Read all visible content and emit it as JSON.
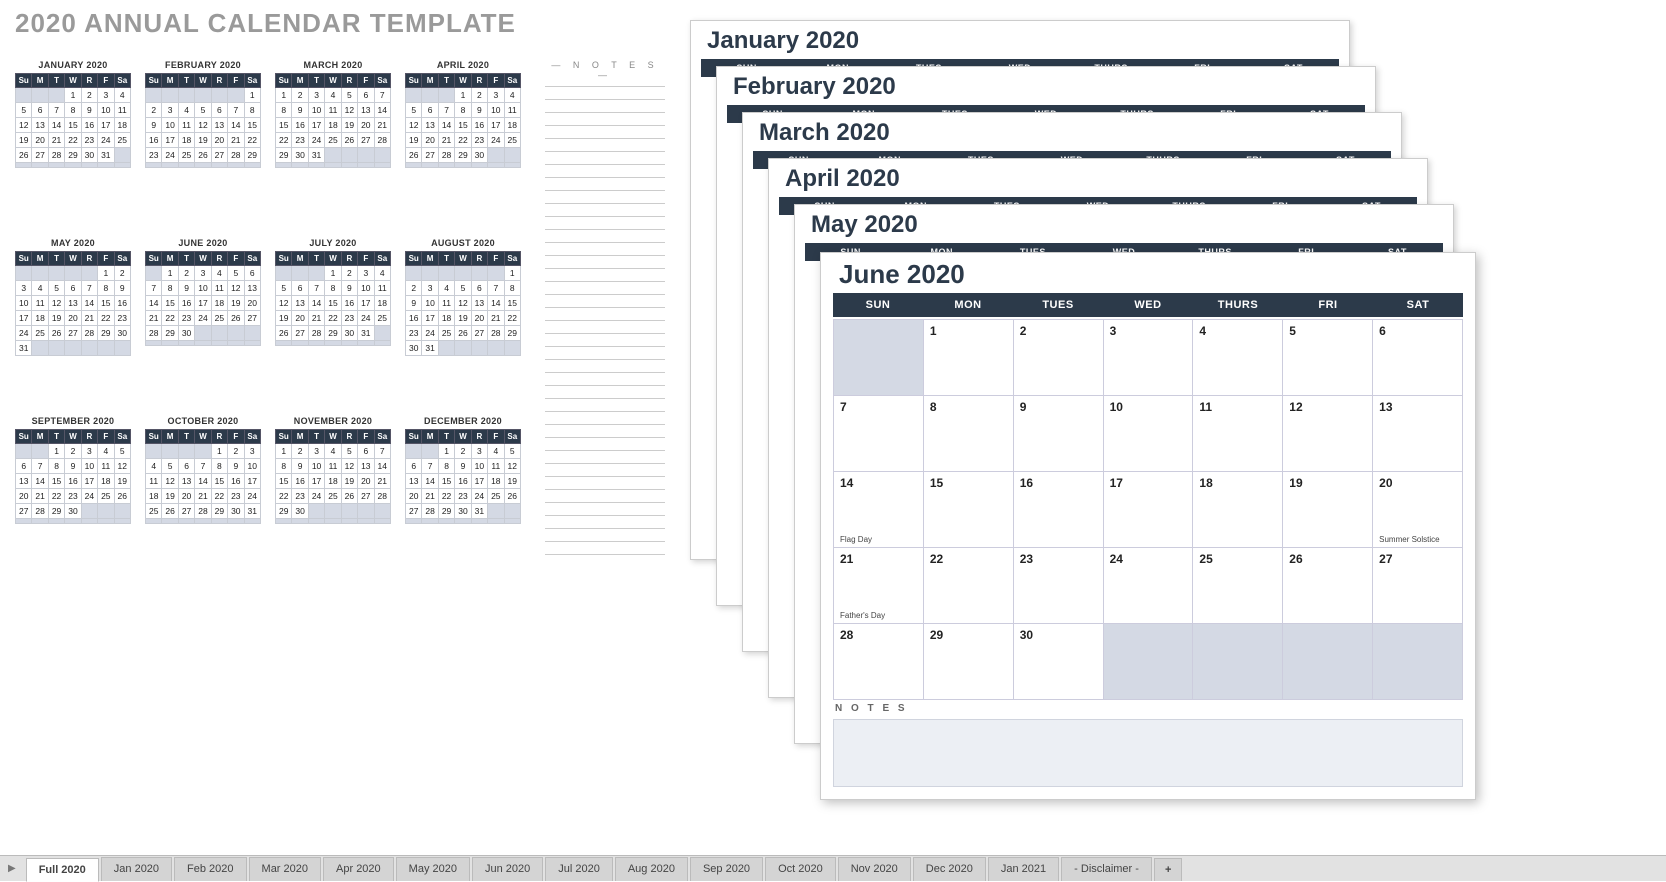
{
  "page_title": "2020 ANNUAL CALENDAR TEMPLATE",
  "notes_header": "— N O T E S —",
  "notes_label": "N O T E S",
  "day_abbr_short": [
    "Su",
    "M",
    "T",
    "W",
    "R",
    "F",
    "Sa"
  ],
  "day_abbr_long": [
    "SUN",
    "MON",
    "TUES",
    "WED",
    "THURS",
    "FRI",
    "SAT"
  ],
  "mini_months": [
    {
      "title": "JANUARY 2020",
      "start": 3,
      "days": 31
    },
    {
      "title": "FEBRUARY 2020",
      "start": 6,
      "days": 29
    },
    {
      "title": "MARCH 2020",
      "start": 0,
      "days": 31
    },
    {
      "title": "APRIL 2020",
      "start": 3,
      "days": 30
    },
    {
      "title": "MAY 2020",
      "start": 5,
      "days": 31
    },
    {
      "title": "JUNE 2020",
      "start": 1,
      "days": 30
    },
    {
      "title": "JULY 2020",
      "start": 3,
      "days": 31
    },
    {
      "title": "AUGUST 2020",
      "start": 6,
      "days": 31
    },
    {
      "title": "SEPTEMBER 2020",
      "start": 2,
      "days": 30
    },
    {
      "title": "OCTOBER 2020",
      "start": 4,
      "days": 31
    },
    {
      "title": "NOVEMBER 2020",
      "start": 0,
      "days": 30
    },
    {
      "title": "DECEMBER 2020",
      "start": 2,
      "days": 31
    }
  ],
  "stacked_sheets": [
    {
      "title": "January 2020"
    },
    {
      "title": "February 2020"
    },
    {
      "title": "March 2020"
    },
    {
      "title": "April 2020"
    },
    {
      "title": "May 2020"
    }
  ],
  "front_sheet": {
    "title": "June 2020",
    "start": 1,
    "days": 30,
    "events": {
      "14": "Flag Day",
      "20": "Summer Solstice",
      "21": "Father's Day"
    }
  },
  "tabs": [
    {
      "label": "Full 2020",
      "active": true
    },
    {
      "label": "Jan 2020"
    },
    {
      "label": "Feb 2020"
    },
    {
      "label": "Mar 2020"
    },
    {
      "label": "Apr 2020"
    },
    {
      "label": "May 2020"
    },
    {
      "label": "Jun 2020"
    },
    {
      "label": "Jul 2020"
    },
    {
      "label": "Aug 2020"
    },
    {
      "label": "Sep 2020"
    },
    {
      "label": "Oct 2020"
    },
    {
      "label": "Nov 2020"
    },
    {
      "label": "Dec 2020"
    },
    {
      "label": "Jan 2021"
    },
    {
      "label": "- Disclaimer -"
    }
  ],
  "add_tab": "+"
}
